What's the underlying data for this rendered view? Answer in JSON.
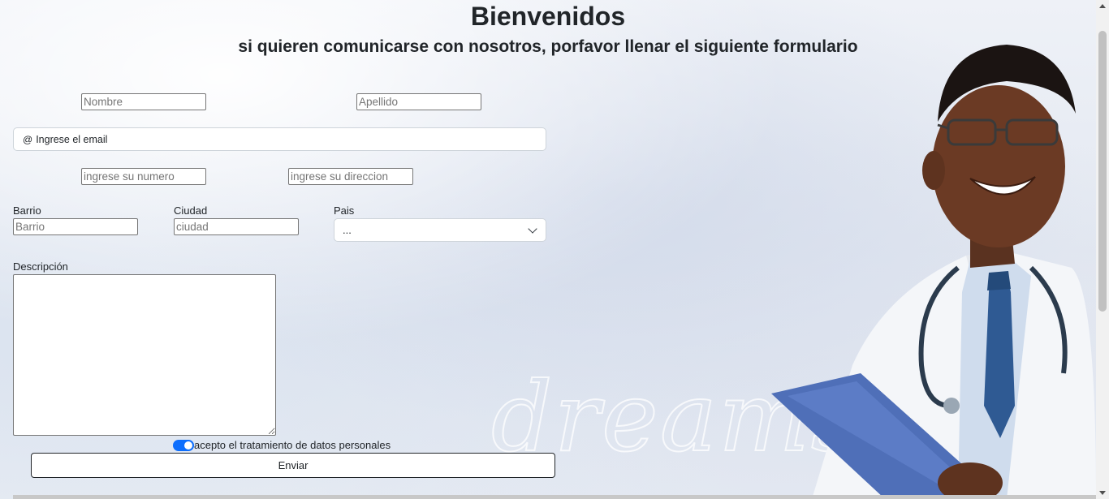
{
  "header": {
    "title": "Bienvenidos",
    "subtitle": "si quieren comunicarse con nosotros, porfavor llenar el siguiente formulario"
  },
  "form": {
    "nombre_placeholder": "Nombre",
    "apellido_placeholder": "Apellido",
    "email_prefix": "@",
    "email_placeholder": "Ingrese el email",
    "numero_placeholder": "ingrese su numero",
    "direccion_placeholder": "ingrese su direccion",
    "barrio_label": "Barrio",
    "barrio_placeholder": "Barrio",
    "ciudad_label": "Ciudad",
    "ciudad_placeholder": "ciudad",
    "pais_label": "Pais",
    "pais_selected": "...",
    "descripcion_label": "Descripción",
    "consent_label": "acepto el tratamiento de datos personales",
    "consent_checked": true,
    "submit_label": "Enviar"
  },
  "background": {
    "watermark": "dreamstime"
  },
  "colors": {
    "accent": "#0d6efd",
    "text": "#212529"
  }
}
